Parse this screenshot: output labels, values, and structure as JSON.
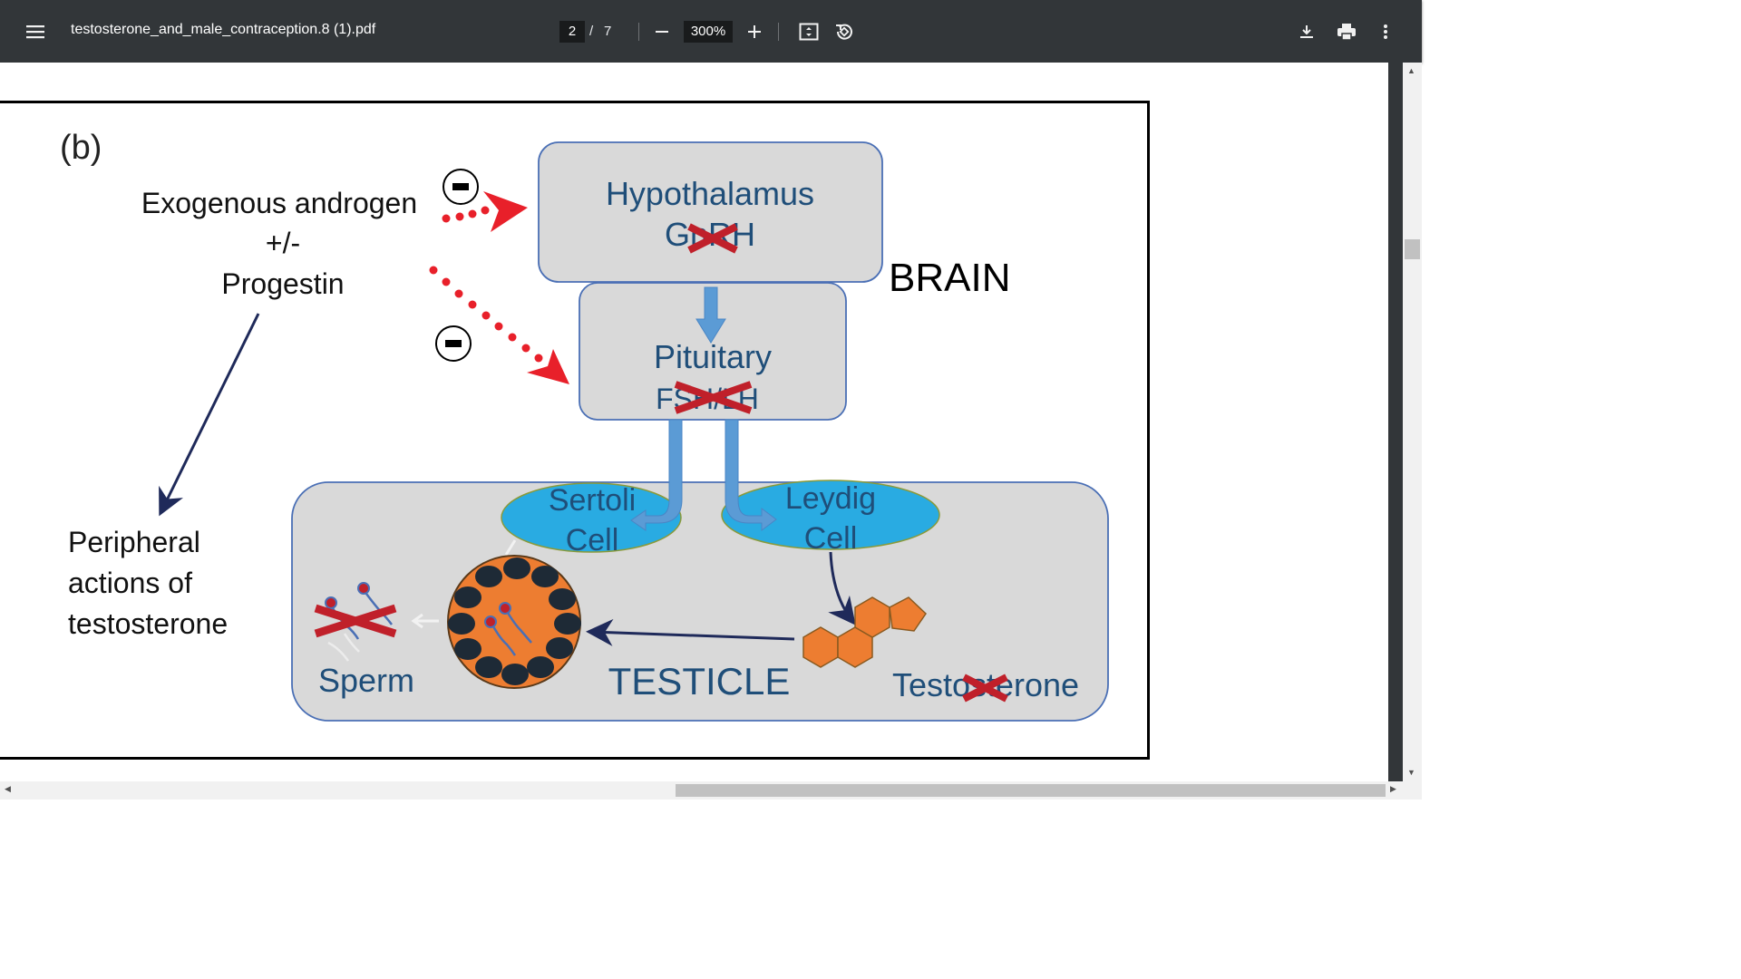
{
  "toolbar": {
    "filename": "testosterone_and_male_contraception.8 (1).pdf",
    "current_page": "2",
    "page_separator": "/",
    "total_pages": "7",
    "zoom": "300%",
    "zoom_out_symbol": "−",
    "zoom_in_symbol": "+"
  },
  "figure": {
    "panel_label": "(b)",
    "exogenous": [
      "Exogenous androgen",
      "+/-",
      "Progestin"
    ],
    "peripheral": [
      "Peripheral",
      "actions of",
      "testosterone"
    ],
    "brain_label": "BRAIN",
    "hypothalamus": {
      "title": "Hypothalamus",
      "hormone": "GnRH"
    },
    "pituitary": {
      "title": "Pituitary",
      "hormone": "FSH/LH"
    },
    "sertoli": [
      "Sertoli",
      "Cell"
    ],
    "leydig": [
      "Leydig",
      "Cell"
    ],
    "sperm_label": "Sperm",
    "testicle_label": "TESTICLE",
    "testosterone_label": "Testosterone",
    "inhibit_symbol": "−"
  },
  "colors": {
    "toolbar_bg": "#323639",
    "box_fill": "#d9d9d9",
    "box_stroke": "#4a6fb5",
    "label_blue": "#1f4e79",
    "cell_fill": "#29abe2",
    "arrow_blue": "#5b9bd5",
    "red": "#e8202a",
    "cross_red": "#c0202a",
    "orange": "#ed7d31",
    "navy": "#1f2a5a"
  }
}
